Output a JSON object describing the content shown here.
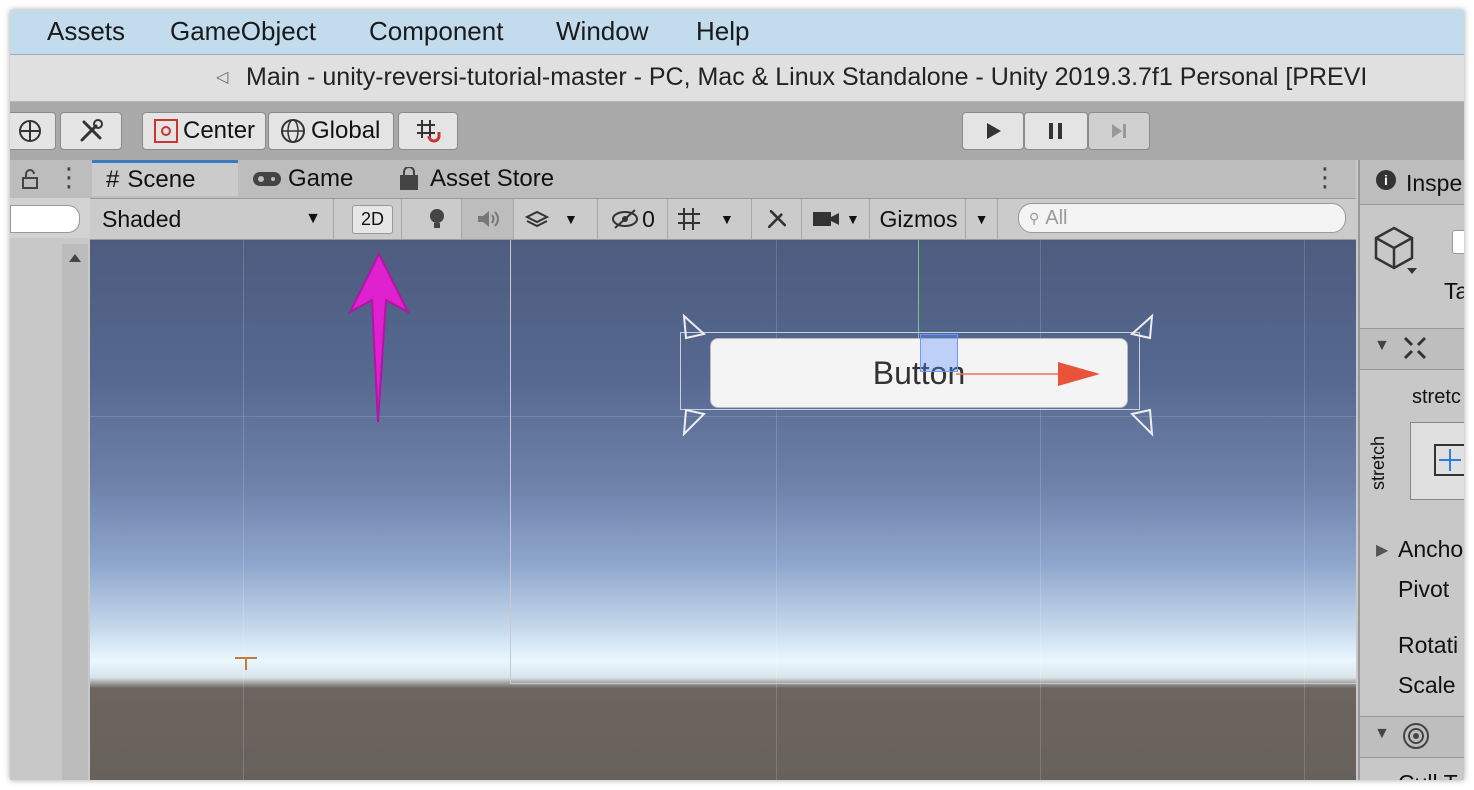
{
  "menu": [
    "Assets",
    "GameObject",
    "Component",
    "Window",
    "Help"
  ],
  "title": "Main - unity-reversi-tutorial-master - PC, Mac & Linux Standalone - Unity 2019.3.7f1 Personal [PREVI",
  "toolbar": {
    "pivot_label": "Center",
    "space_label": "Global"
  },
  "scene_tabs": [
    {
      "label": "Scene",
      "icon": "hash-icon",
      "active": true
    },
    {
      "label": "Game",
      "icon": "gamepad-icon",
      "active": false
    },
    {
      "label": "Asset Store",
      "icon": "bag-icon",
      "active": false
    }
  ],
  "scene_bar": {
    "draw_mode": "Shaded",
    "mode_2d": "2D",
    "hidden_count": "0",
    "gizmos": "Gizmos",
    "search_placeholder": "All"
  },
  "viewport": {
    "button_text": "Button",
    "annotation_arrow_color": "#e021d0"
  },
  "inspector": {
    "tab_label": "Inspe",
    "tag_label": "Ta",
    "stretch_top": "stretc",
    "stretch_side": "stretch",
    "anchors": "Ancho",
    "pivot": "Pivot",
    "rotation": "Rotati",
    "scale": "Scale",
    "cull": "Cull T"
  }
}
